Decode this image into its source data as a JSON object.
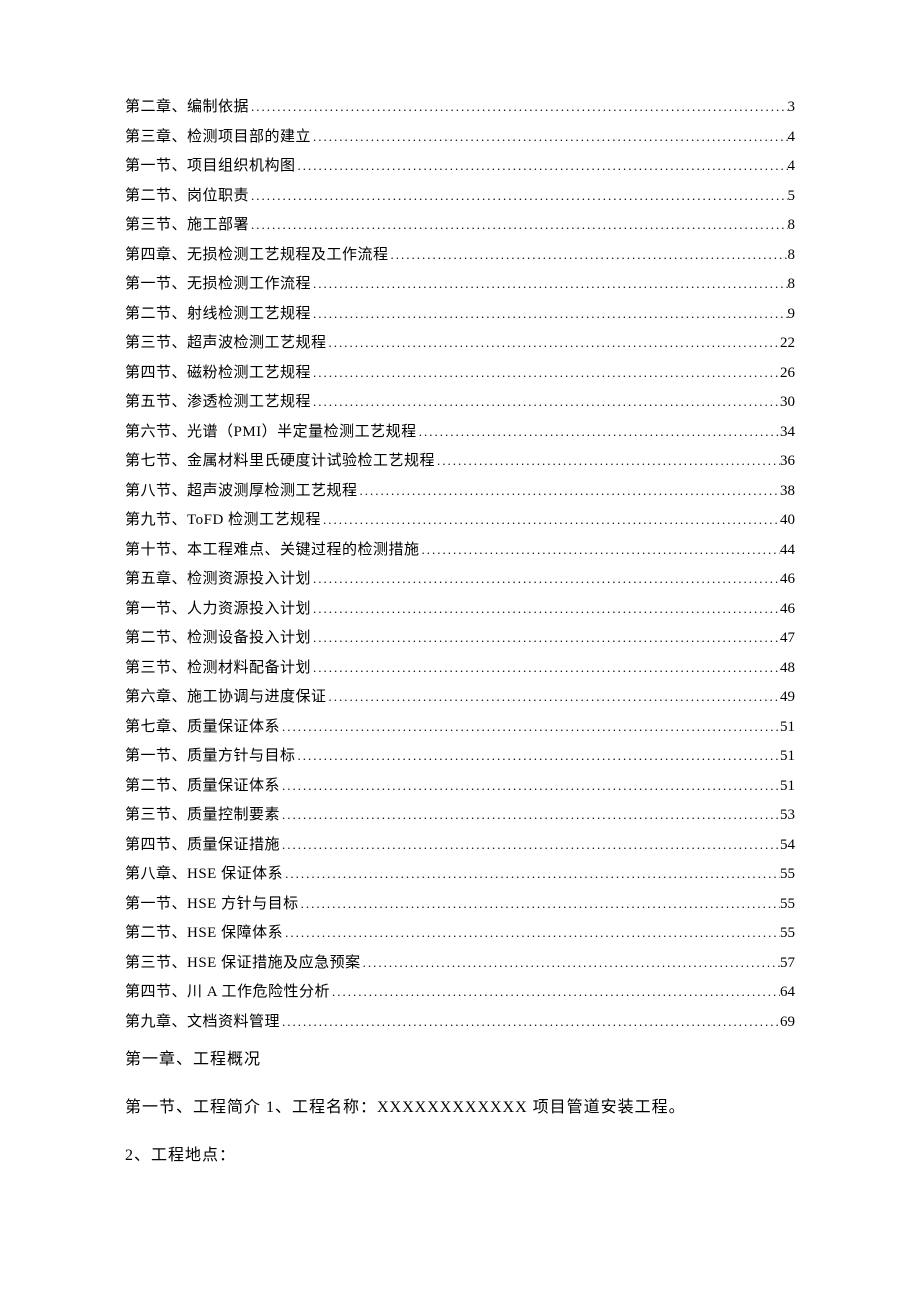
{
  "toc": [
    {
      "label": "第二章、编制依据",
      "page": "3"
    },
    {
      "label": "第三章、检测项目部的建立",
      "page": "4"
    },
    {
      "label": "第一节、项目组织机构图",
      "page": "4"
    },
    {
      "label": "第二节、岗位职责",
      "page": "5"
    },
    {
      "label": "第三节、施工部署",
      "page": "8"
    },
    {
      "label": "第四章、无损检测工艺规程及工作流程",
      "page": "8"
    },
    {
      "label": "第一节、无损检测工作流程",
      "page": "8"
    },
    {
      "label": "第二节、射线检测工艺规程",
      "page": "9"
    },
    {
      "label": "第三节、超声波检测工艺规程",
      "page": "22"
    },
    {
      "label": "第四节、磁粉检测工艺规程",
      "page": "26"
    },
    {
      "label": "第五节、渗透检测工艺规程",
      "page": "30"
    },
    {
      "label": "第六节、光谱（PMI）半定量检测工艺规程 ",
      "page": "34"
    },
    {
      "label": "第七节、金属材料里氏硬度计试验检工艺规程",
      "page": "36"
    },
    {
      "label": "第八节、超声波测厚检测工艺规程",
      "page": "38"
    },
    {
      "label": "第九节、ToFD 检测工艺规程",
      "page": "40"
    },
    {
      "label": "第十节、本工程难点、关键过程的检测措施",
      "page": "44"
    },
    {
      "label": "第五章、检测资源投入计划",
      "page": "46"
    },
    {
      "label": "第一节、人力资源投入计划",
      "page": "46"
    },
    {
      "label": "第二节、检测设备投入计划",
      "page": "47"
    },
    {
      "label": "第三节、检测材料配备计划",
      "page": "48"
    },
    {
      "label": "第六章、施工协调与进度保证",
      "page": "49"
    },
    {
      "label": "第七章、质量保证体系",
      "page": "51"
    },
    {
      "label": "第一节、质量方针与目标",
      "page": "51"
    },
    {
      "label": "第二节、质量保证体系",
      "page": "51"
    },
    {
      "label": "第三节、质量控制要素",
      "page": "53"
    },
    {
      "label": "第四节、质量保证措施",
      "page": "54"
    },
    {
      "label": "第八章、HSE 保证体系",
      "page": "55"
    },
    {
      "label": "第一节、HSE 方针与目标",
      "page": "55"
    },
    {
      "label": "第二节、HSE 保障体系",
      "page": "55"
    },
    {
      "label": "第三节、HSE 保证措施及应急预案",
      "page": "57"
    },
    {
      "label": "第四节、川 A 工作危险性分析",
      "page": "64"
    },
    {
      "label": "第九章、文档资料管理",
      "page": "69"
    }
  ],
  "body": {
    "heading": "第一章、工程概况",
    "line1": "第一节、工程简介 1、工程名称：XXXXXXXXXXXX 项目管道安装工程。",
    "line2": "2、工程地点："
  }
}
